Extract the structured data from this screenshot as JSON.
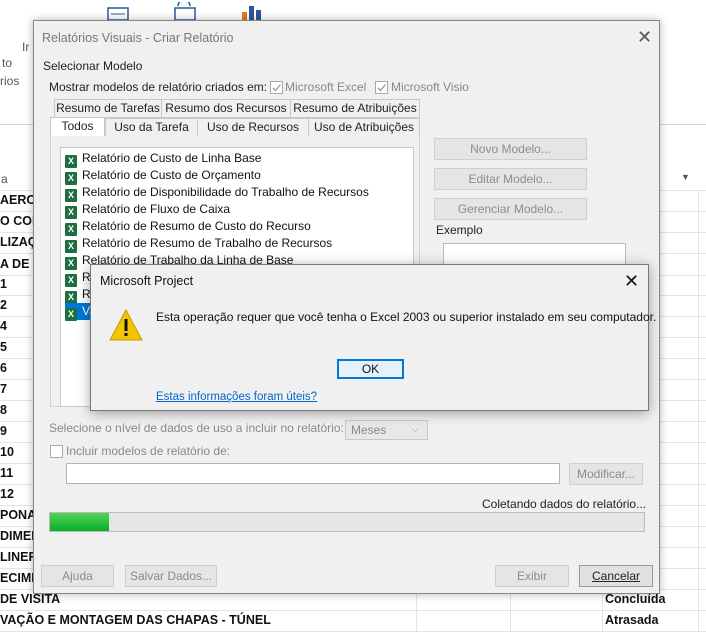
{
  "background": {
    "ribbon_labels": [
      "Ir",
      "to",
      "rios"
    ],
    "column_header_left": "a",
    "rows": [
      {
        "left": "AERO",
        "right": "a"
      },
      {
        "left": "O COI",
        "right": "a"
      },
      {
        "left": "LIZAÇ",
        "right": "a"
      },
      {
        "left": "A DE D",
        "right": ""
      },
      {
        "left": "1",
        "right": ""
      },
      {
        "left": "2",
        "right": ""
      },
      {
        "left": "4",
        "right": ""
      },
      {
        "left": "5",
        "right": ""
      },
      {
        "left": "6",
        "right": ""
      },
      {
        "left": "7",
        "right": "a"
      },
      {
        "left": "8",
        "right": "a"
      },
      {
        "left": "9",
        "right": ""
      },
      {
        "left": "10",
        "right": "tura"
      },
      {
        "left": "11",
        "right": "tura"
      },
      {
        "left": "12",
        "right": "tura"
      },
      {
        "left": "PONAL",
        "right": "tura"
      },
      {
        "left": "DIMEN",
        "right": ""
      },
      {
        "left": "LINER",
        "right": ""
      },
      {
        "left": "ECIMI",
        "right": ""
      },
      {
        "left": "DE VISITA",
        "right": "Concluída"
      },
      {
        "left": "VAÇÃO E MONTAGEM DAS CHAPAS - TÚNEL",
        "right": "Atrasada"
      }
    ]
  },
  "dialog": {
    "title": "Relatórios Visuais - Criar Relatório",
    "section_label": "Selecionar Modelo",
    "show_label": "Mostrar modelos de relatório criados em:",
    "check_excel": "Microsoft Excel",
    "check_visio": "Microsoft Visio",
    "tabs_row1": [
      "Resumo de Tarefas",
      "Resumo dos Recursos",
      "Resumo de Atribuições"
    ],
    "tabs_row2": [
      "Todos",
      "Uso da Tarefa",
      "Uso de Recursos",
      "Uso de Atribuições"
    ],
    "list_items": [
      "Relatório de Custo de Linha Base",
      "Relatório de Custo de Orçamento",
      "Relatório de Disponibilidade do Trabalho de Recursos",
      "Relatório de Fluxo de Caixa",
      "Relatório de Resumo de Custo do Recurso",
      "Relatório de Resumo de Trabalho de Recursos",
      "Relatório de Trabalho da Linha de Base",
      "Re",
      "Re",
      "Va"
    ],
    "btn_new": "Novo Modelo...",
    "btn_edit": "Editar Modelo...",
    "btn_manage": "Gerenciar Modelo...",
    "example_label": "Exemplo",
    "level_label": "Selecione o nível de dados de uso a incluir no relatório:",
    "level_value": "Meses",
    "include_label": "Incluir modelos de relatório de:",
    "btn_modify": "Modificar...",
    "status_text": "Coletando dados do relatório...",
    "progress": 0.1,
    "btn_help": "Ajuda",
    "btn_save": "Salvar Dados...",
    "btn_view": "Exibir",
    "btn_cancel": "Cancelar"
  },
  "message": {
    "title": "Microsoft Project",
    "text": "Esta operação requer que você tenha o Excel 2003 ou superior instalado em seu computador.",
    "ok": "OK",
    "link": "Estas informações foram úteis?"
  },
  "colors": {
    "progress_fill": "#06b025",
    "link": "#0066cc",
    "selection": "#0078d7",
    "excel_icon": "#1d6f42",
    "warning": "#f5c400"
  }
}
